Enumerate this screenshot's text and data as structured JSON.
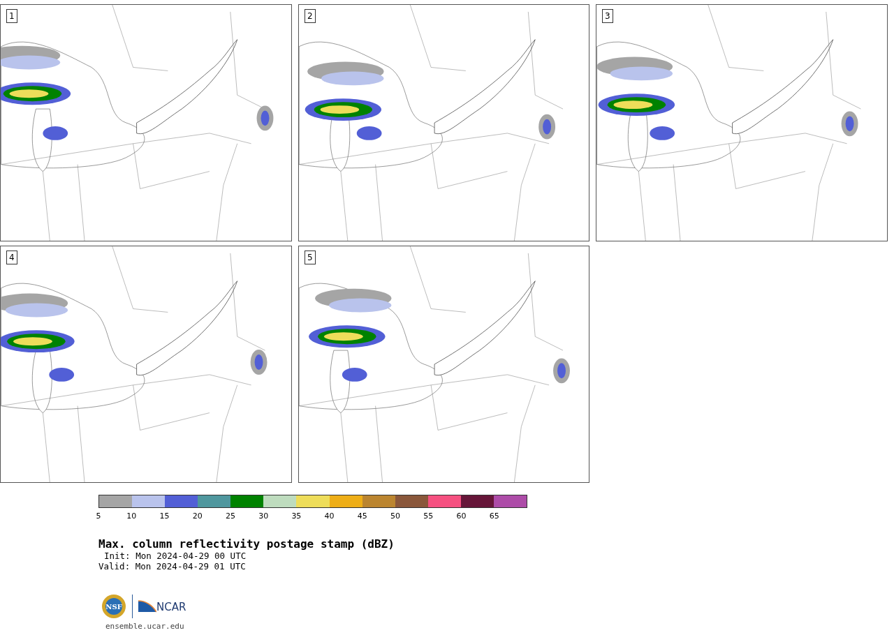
{
  "panels": [
    {
      "label": "1"
    },
    {
      "label": "2"
    },
    {
      "label": "3"
    },
    {
      "label": "4"
    },
    {
      "label": "5"
    }
  ],
  "colorbar": [
    {
      "label": "5",
      "color": "#a5a5a5"
    },
    {
      "label": "10",
      "color": "#b9c3ec"
    },
    {
      "label": "15",
      "color": "#525fd6"
    },
    {
      "label": "20",
      "color": "#4f979e"
    },
    {
      "label": "25",
      "color": "#008200"
    },
    {
      "label": "30",
      "color": "#bedcbe"
    },
    {
      "label": "35",
      "color": "#eedd5a"
    },
    {
      "label": "40",
      "color": "#eeae17"
    },
    {
      "label": "45",
      "color": "#bb8530"
    },
    {
      "label": "50",
      "color": "#8a573b"
    },
    {
      "label": "55",
      "color": "#f55080"
    },
    {
      "label": "60",
      "color": "#661639"
    },
    {
      "label": "65",
      "color": "#ad4ca8"
    }
  ],
  "title": "Max. column reflectivity postage stamp (dBZ)",
  "init": "Init: Mon 2024-04-29 00 UTC",
  "valid": "Valid: Mon 2024-04-29 01 UTC",
  "logos": {
    "nsf": "NSF",
    "ncar": "NCAR"
  },
  "footer": "ensemble.ucar.edu"
}
